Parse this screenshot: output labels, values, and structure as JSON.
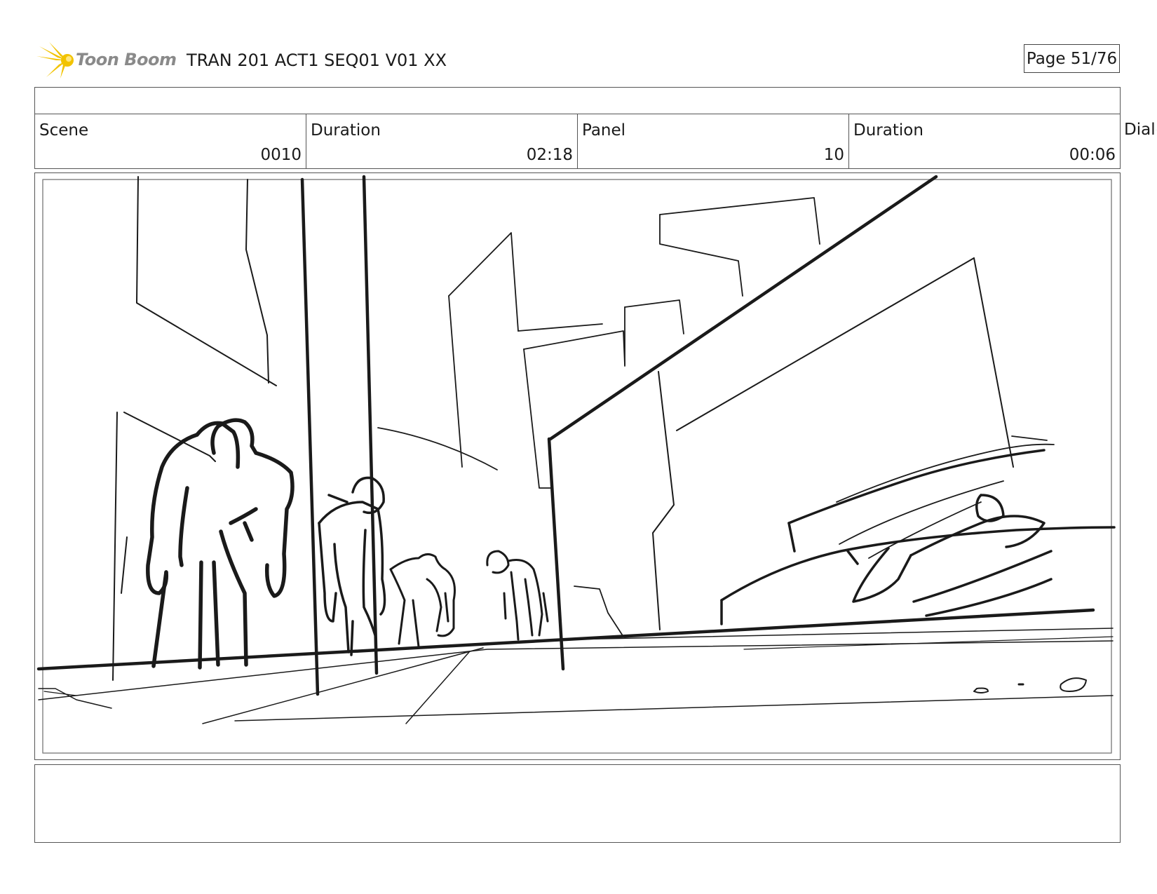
{
  "header": {
    "logo_text": "Toon Boom",
    "document_title": "TRAN 201 ACT1 SEQ01 V01 XX",
    "page_label": "Page 51/76"
  },
  "info": {
    "scene_label": "Scene",
    "scene_value": "0010",
    "scene_duration_label": "Duration",
    "scene_duration_value": "02:18",
    "panel_label": "Panel",
    "panel_value": "10",
    "panel_duration_label": "Duration",
    "panel_duration_value": "00:06",
    "dialog_label": "Dialog"
  },
  "colors": {
    "logo_yellow": "#f2c300",
    "logo_text_gray": "#8a8a8a",
    "sketch_ink": "#1a1a1a"
  },
  "icons": [
    "toon-boom-starburst-icon"
  ]
}
